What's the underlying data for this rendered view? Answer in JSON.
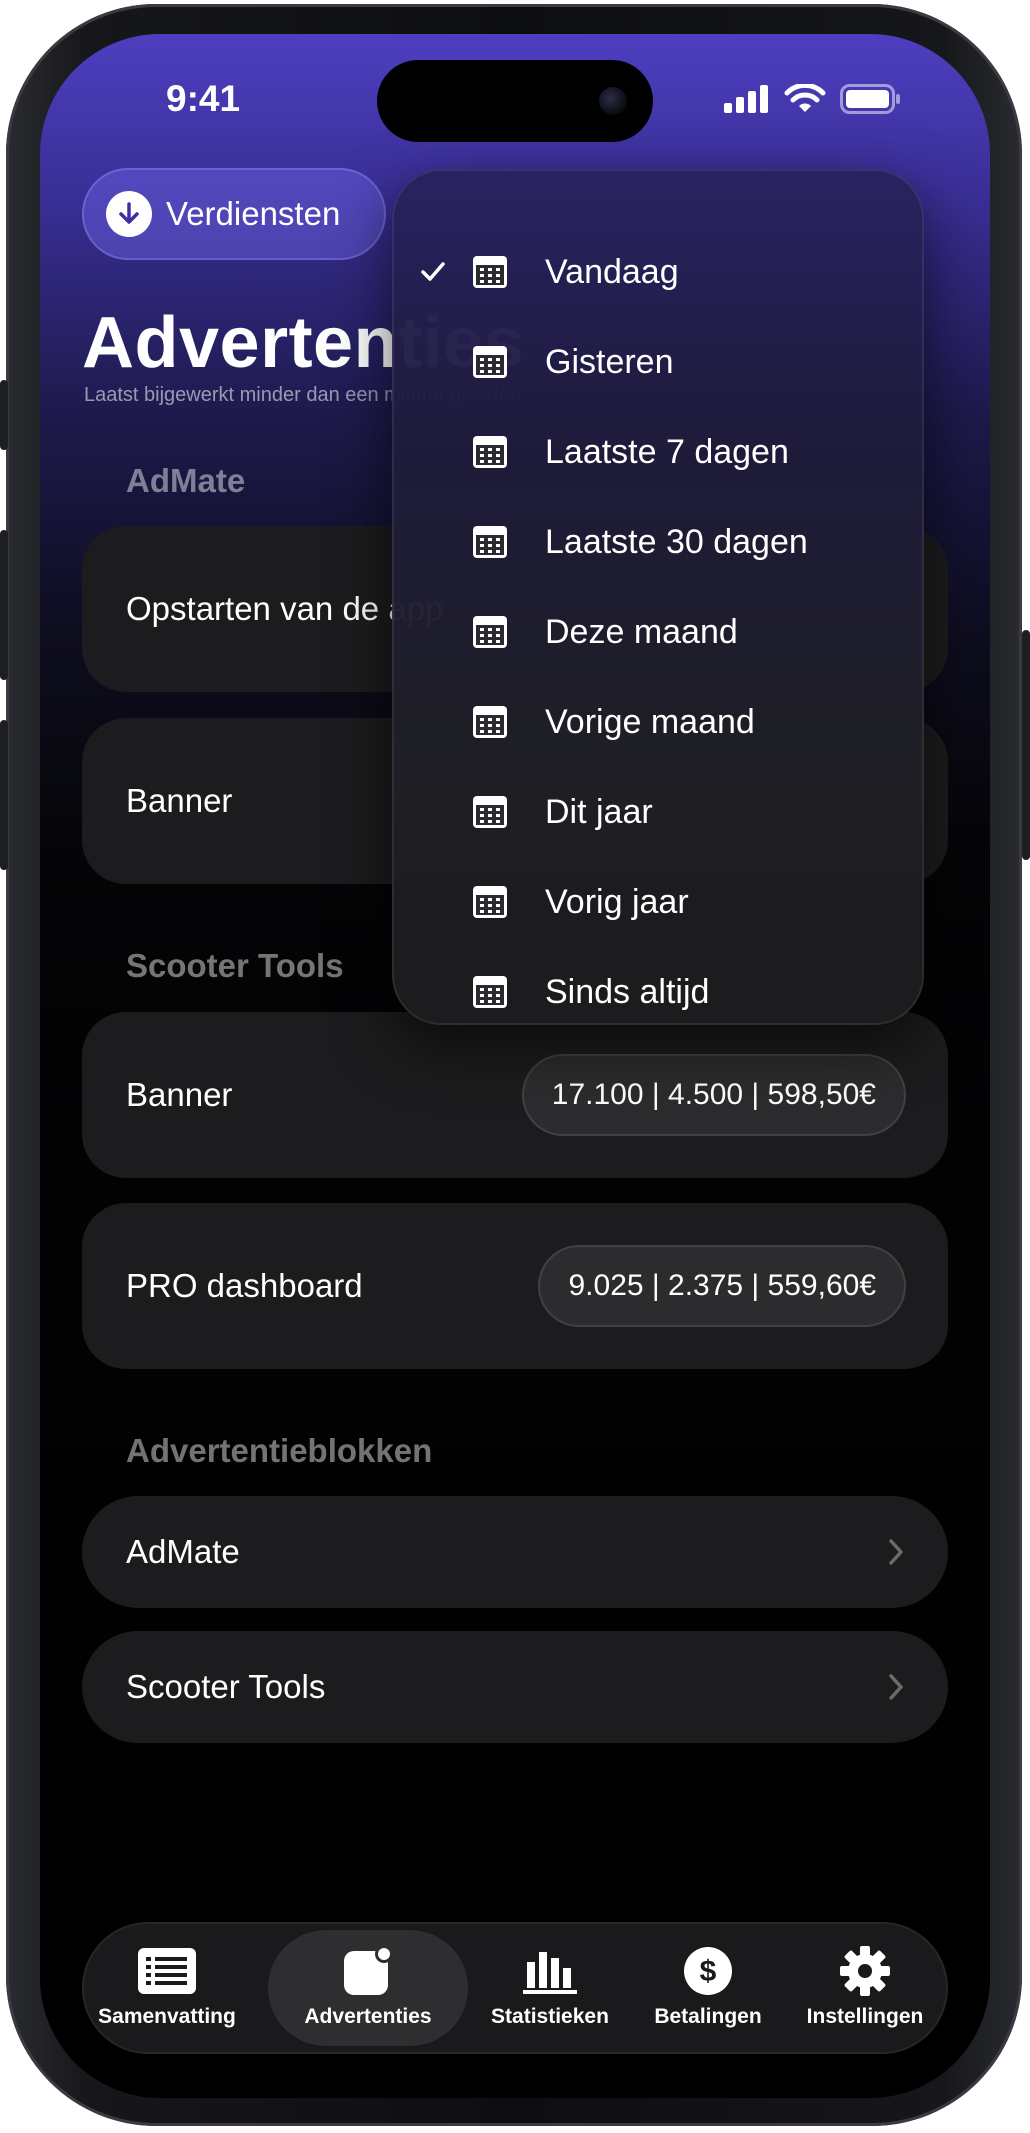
{
  "status": {
    "time": "9:41"
  },
  "header": {
    "earnings_button": "Verdiensten",
    "title": "Advertenties",
    "subtitle": "Laatst bijgewerkt minder dan een minuut geleden"
  },
  "sections": [
    {
      "title": "AdMate",
      "items": [
        {
          "label": "Opstarten van de app",
          "value": ""
        },
        {
          "label": "Banner",
          "value": ""
        }
      ]
    },
    {
      "title": "Scooter Tools",
      "items": [
        {
          "label": "Banner",
          "value": "17.100 | 4.500 | 598,50€"
        },
        {
          "label": "PRO dashboard",
          "value": "9.025 | 2.375 | 559,60€"
        }
      ]
    },
    {
      "title": "Advertentieblokken",
      "items": [
        {
          "label": "AdMate"
        },
        {
          "label": "Scooter Tools"
        }
      ]
    }
  ],
  "date_menu": {
    "selected_index": 0,
    "options": [
      "Vandaag",
      "Gisteren",
      "Laatste 7 dagen",
      "Laatste 30 dagen",
      "Deze maand",
      "Vorige maand",
      "Dit jaar",
      "Vorig jaar",
      "Sinds altijd"
    ]
  },
  "tabbar": {
    "active": "Advertenties",
    "tabs": [
      {
        "label": "Samenvatting",
        "icon": "list-icon"
      },
      {
        "label": "Advertenties",
        "icon": "ad-badge-icon"
      },
      {
        "label": "Statistieken",
        "icon": "bar-chart-icon"
      },
      {
        "label": "Betalingen",
        "icon": "dollar-circle-icon"
      },
      {
        "label": "Instellingen",
        "icon": "gear-icon"
      }
    ]
  },
  "colors": {
    "accent_top": "#4d3fc0",
    "card": "#1c1c1e",
    "pill": "#2c2c2e"
  }
}
